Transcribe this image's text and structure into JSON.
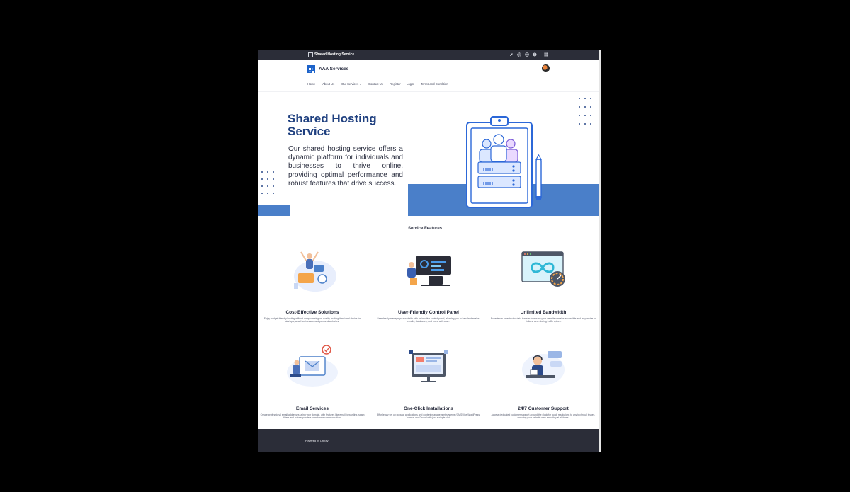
{
  "control_bar": {
    "page_title": "Shared Hosting Service"
  },
  "header": {
    "brand": "AAA Services"
  },
  "nav": {
    "items": [
      "Home",
      "About Us",
      "Our Services",
      "Contact Us",
      "Register",
      "Login",
      "Terms and Condition"
    ],
    "caret": "⌄"
  },
  "hero": {
    "title": "Shared Hosting Service",
    "description": "Our shared hosting service offers a dynamic platform for individuals and businesses to thrive online, providing optimal performance and robust features that drive success."
  },
  "features": {
    "title": "Service Features",
    "cards": [
      {
        "title": "Cost-Effective Solutions",
        "desc": "Enjoy budget-friendly hosting without compromising on quality, making it an ideal choice for startups, small businesses, and personal websites."
      },
      {
        "title": "User-Friendly Control Panel",
        "desc": "Seamlessly manage your website with an intuitive control panel, allowing you to handle domains, emails, databases, and more with ease."
      },
      {
        "title": "Unlimited Bandwidth",
        "desc": "Experience unrestricted data transfer to ensure your website remains accessible and responsive to visitors, even during traffic spikes."
      },
      {
        "title": "Email Services",
        "desc": "Create professional email addresses using your domain, with features like email forwarding, spam filters and autoresponders to enhance communication."
      },
      {
        "title": "One-Click Installations",
        "desc": "Effortlessly set up popular applications and content management systems (CMS) like WordPress, Joomla, and Drupal with just a single click."
      },
      {
        "title": "24/7 Customer Support",
        "desc": "Access dedicated customer support around the clock for quick resolutions to any technical issues, ensuring your website runs smoothly at all times."
      }
    ]
  },
  "footer": {
    "text": "Powered by Liferay"
  },
  "colors": {
    "brand_blue": "#1d63c9",
    "hero_title": "#1e3f7f",
    "accent_block": "#4a7fc9",
    "dark_bar": "#2b2d38"
  }
}
